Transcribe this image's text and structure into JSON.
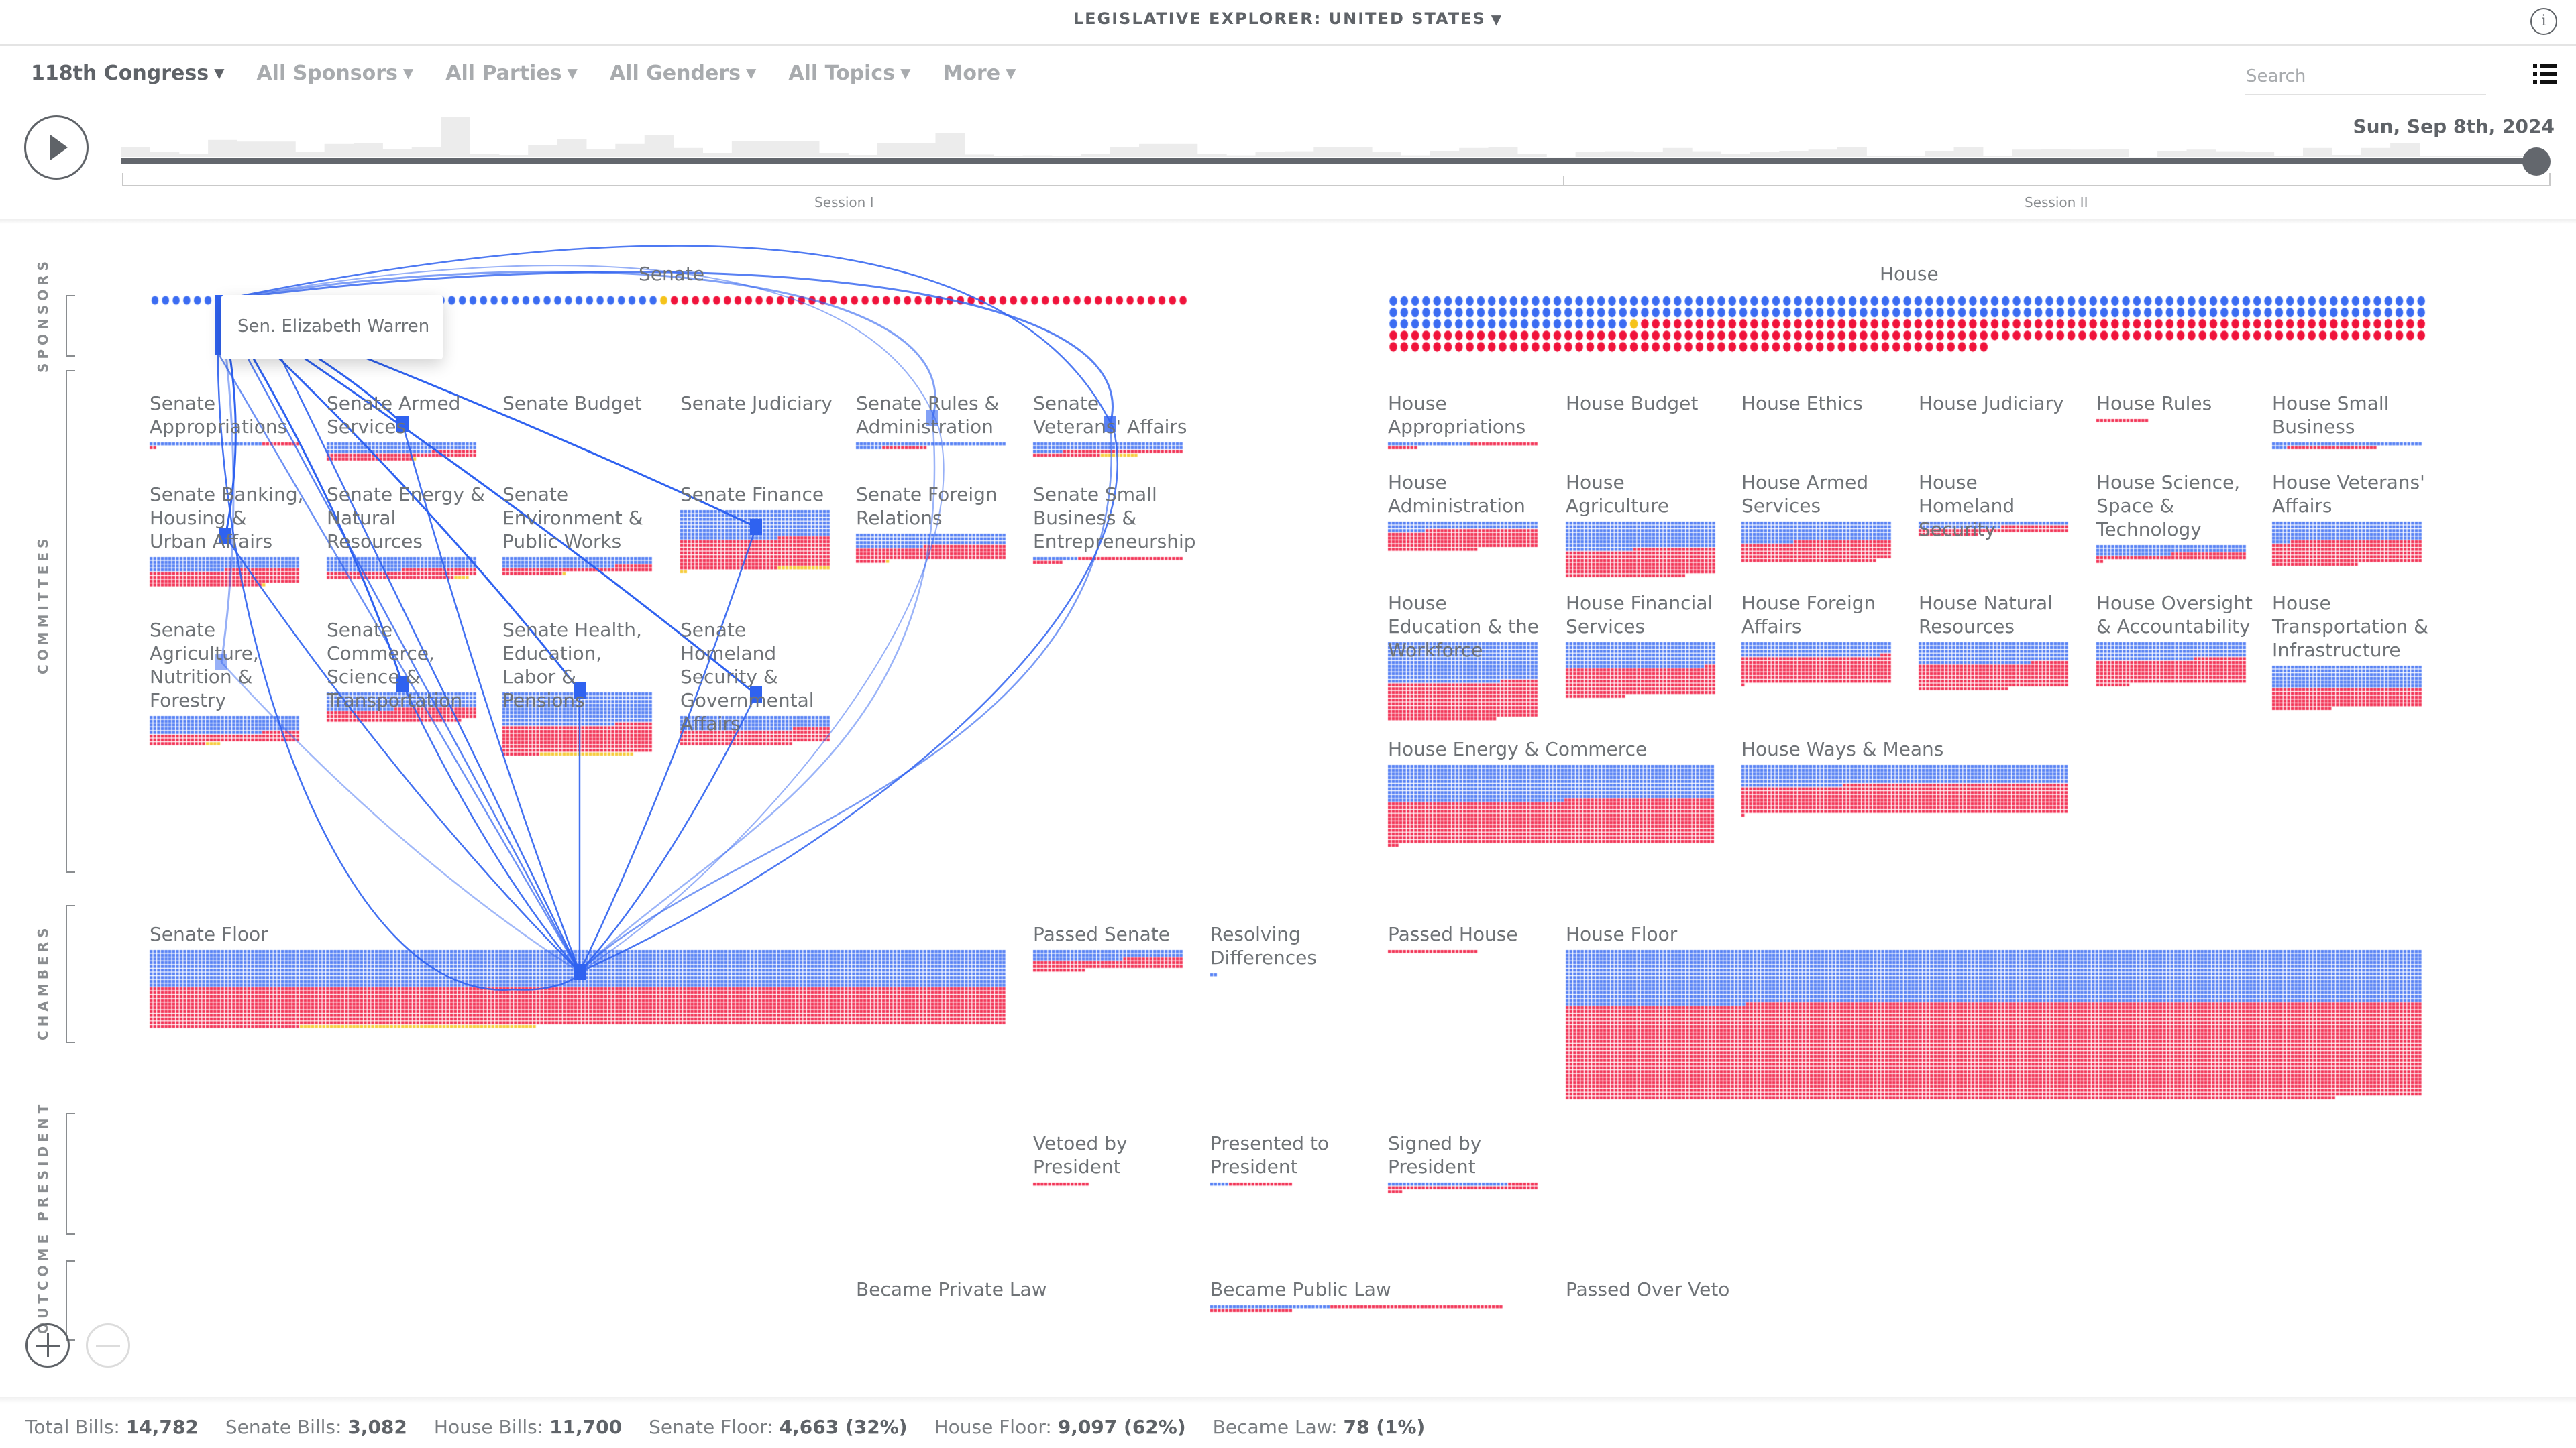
{
  "header": {
    "title": "LEGISLATIVE EXPLORER: UNITED STATES",
    "info_icon": "info-icon"
  },
  "filters": [
    {
      "label": "118th Congress",
      "active": true
    },
    {
      "label": "All Sponsors",
      "active": false
    },
    {
      "label": "All Parties",
      "active": false
    },
    {
      "label": "All Genders",
      "active": false
    },
    {
      "label": "All Topics",
      "active": false
    },
    {
      "label": "More",
      "active": false
    }
  ],
  "search": {
    "placeholder": "Search",
    "value": ""
  },
  "list_view_icon": "list-icon",
  "timeline": {
    "current_date": "Sun, Sep 8th, 2024",
    "progress": 1.0,
    "sessions": [
      "Session I",
      "Session II"
    ],
    "activity_histogram": [
      0.25,
      0.12,
      0.08,
      0.42,
      0.38,
      0.38,
      0.12,
      0.32,
      0.35,
      0.2,
      0.25,
      1.0,
      0.08,
      0.05,
      0.3,
      0.45,
      0.2,
      0.32,
      0.55,
      0.22,
      0.1,
      0.4,
      0.4,
      0.4,
      0.1,
      0.05,
      0.35,
      0.35,
      0.6,
      0.06,
      0.02,
      0.04,
      0.02,
      0.08,
      0.25,
      0.32,
      0.32,
      0.08,
      0.04,
      0.12,
      0.14,
      0.25,
      0.25,
      0.12,
      0.04,
      0.15,
      0.22,
      0.25,
      0.08,
      0.0,
      0.12,
      0.14,
      0.12,
      0.22,
      0.14,
      0.08,
      0.12,
      0.15,
      0.18,
      0.25,
      0.02,
      0.02,
      0.15,
      0.25,
      0.02,
      0.18,
      0.2,
      0.18,
      0.2,
      0.0,
      0.15,
      0.18,
      0.14,
      0.12,
      0.02,
      0.22,
      0.05,
      0.22,
      0.35,
      0.02,
      0.02,
      0.02,
      0.02
    ]
  },
  "colors": {
    "democrat": "#3b6cf2",
    "republican": "#f0133b",
    "independent": "#f5c31a",
    "link": "#2f62f0"
  },
  "side_labels": [
    "SPONSORS",
    "COMMITTEES",
    "CHAMBERS",
    "PRESIDENT",
    "OUTCOME"
  ],
  "sponsors": {
    "senate": {
      "label": "Senate",
      "dem": 48,
      "ind": 1,
      "rep": 49
    },
    "house": {
      "label": "House",
      "dem": 212,
      "ind": 1,
      "rep": 222
    }
  },
  "tooltip": {
    "text": "Sen. Elizabeth Warren"
  },
  "senate_committees": [
    {
      "label": "Senate Appropriations",
      "dem": 30,
      "rep": 12,
      "ind": 0
    },
    {
      "label": "Senate Armed Services",
      "dem": 108,
      "rep": 75,
      "ind": 1
    },
    {
      "label": "Senate Budget",
      "dem": 0,
      "rep": 0,
      "ind": 0
    },
    {
      "label": "Senate Judiciary",
      "dem": 0,
      "rep": 0,
      "ind": 0
    },
    {
      "label": "Senate Rules & Administration",
      "dem": 47,
      "rep": 12,
      "ind": 0
    },
    {
      "label": "Senate Veterans' Affairs",
      "dem": 88,
      "rep": 50,
      "ind": 10
    },
    {
      "label": "Senate Banking, Housing & Urban Affairs",
      "dem": 140,
      "rep": 170,
      "ind": 1
    },
    {
      "label": "Senate Energy & Natural Resources",
      "dem": 140,
      "rep": 94,
      "ind": 4
    },
    {
      "label": "Senate Environment & Public Works",
      "dem": 110,
      "rep": 66,
      "ind": 1
    },
    {
      "label": "Senate Finance",
      "dem": 306,
      "rep": 320,
      "ind": 16
    },
    {
      "label": "Senate Foreign Relations",
      "dem": 138,
      "rep": 150,
      "ind": 1
    },
    {
      "label": "Senate Small Business & Entrepreneurship",
      "dem": 12,
      "rep": 36,
      "ind": 0
    },
    {
      "label": "Senate Agriculture, Nutrition & Forestry",
      "dem": 190,
      "rep": 105,
      "ind": 4
    },
    {
      "label": "Senate Commerce, Science & Transportation",
      "dem": 178,
      "rep": 138,
      "ind": 0
    },
    {
      "label": "Senate Health, Education, Labor & Pensions",
      "dem": 350,
      "rep": 300,
      "ind": 25
    },
    {
      "label": "Senate Homeland Security & Governmental Affairs",
      "dem": 150,
      "rep": 160,
      "ind": 0
    }
  ],
  "house_committees": [
    {
      "label": "House Appropriations",
      "dem": 22,
      "rep": 26,
      "ind": 0
    },
    {
      "label": "House Budget",
      "dem": 0,
      "rep": 0,
      "ind": 0
    },
    {
      "label": "House Ethics",
      "dem": 0,
      "rep": 0,
      "ind": 0
    },
    {
      "label": "House Judiciary",
      "dem": 0,
      "rep": 0,
      "ind": 0
    },
    {
      "label": "House Rules",
      "dem": 0,
      "rep": 14,
      "ind": 0
    },
    {
      "label": "House Small Business",
      "dem": 44,
      "rep": 24,
      "ind": 0
    },
    {
      "label": "House Administration",
      "dem": 90,
      "rep": 214,
      "ind": 0
    },
    {
      "label": "House Agriculture",
      "dem": 298,
      "rep": 294,
      "ind": 0
    },
    {
      "label": "House Armed Services",
      "dem": 214,
      "rep": 222,
      "ind": 0
    },
    {
      "label": "House Homeland Security",
      "dem": 62,
      "rep": 74,
      "ind": 0
    },
    {
      "label": "House Science, Space & Technology",
      "dem": 100,
      "rep": 62,
      "ind": 0
    },
    {
      "label": "House Veterans' Affairs",
      "dem": 205,
      "rep": 258,
      "ind": 0
    },
    {
      "label": "House Education & the Workforce",
      "dem": 430,
      "rep": 399,
      "ind": 0
    },
    {
      "label": "House Financial Services",
      "dem": 277,
      "rep": 299,
      "ind": 0
    },
    {
      "label": "House Foreign Affairs",
      "dem": 157,
      "rep": 284,
      "ind": 0
    },
    {
      "label": "House Natural Resources",
      "dem": 230,
      "rep": 274,
      "ind": 0
    },
    {
      "label": "House Oversight & Accountability",
      "dem": 186,
      "rep": 263,
      "ind": 0
    },
    {
      "label": "House Transportation & Infrastructure",
      "dem": 240,
      "rep": 216,
      "ind": 0
    },
    {
      "label": "House Energy & Commerce",
      "dem": 830,
      "rep": 1000,
      "ind": 0
    },
    {
      "label": "House Ways & Means",
      "dem": 462,
      "rep": 670,
      "ind": 0
    }
  ],
  "chambers": [
    {
      "label": "Senate Floor",
      "dem": 2280,
      "rep": 2320,
      "ind": 63
    },
    {
      "label": "Passed Senate",
      "dem": 104,
      "rep": 110,
      "ind": 0
    },
    {
      "label": "Resolving Differences",
      "dem": 2,
      "rep": 0,
      "ind": 0
    },
    {
      "label": "Passed House",
      "dem": 0,
      "rep": 24,
      "ind": 0
    },
    {
      "label": "House Floor",
      "dem": 3240,
      "rep": 5857,
      "ind": 0
    }
  ],
  "president": [
    {
      "label": "Vetoed by President",
      "dem": 0,
      "rep": 15,
      "ind": 0
    },
    {
      "label": "Presented to President",
      "dem": 5,
      "rep": 17,
      "ind": 0
    },
    {
      "label": "Signed by President",
      "dem": 32,
      "rep": 52,
      "ind": 0
    }
  ],
  "outcome": [
    {
      "label": "Became Private Law",
      "dem": 0,
      "rep": 0,
      "ind": 0
    },
    {
      "label": "Became Public Law",
      "dem": 32,
      "rep": 68,
      "ind": 0
    },
    {
      "label": "Passed Over Veto",
      "dem": 0,
      "rep": 0,
      "ind": 0
    }
  ],
  "zoom_controls": {
    "zoom_in_icon": "plus-icon",
    "zoom_out_icon": "minus-icon"
  },
  "stats": [
    {
      "label": "Total Bills:",
      "value": "14,782"
    },
    {
      "label": "Senate Bills:",
      "value": "3,082"
    },
    {
      "label": "House Bills:",
      "value": "11,700"
    },
    {
      "label": "Senate Floor:",
      "value": "4,663 (32%)"
    },
    {
      "label": "House Floor:",
      "value": "9,097 (62%)"
    },
    {
      "label": "Became Law:",
      "value": "78 (1%)"
    }
  ]
}
